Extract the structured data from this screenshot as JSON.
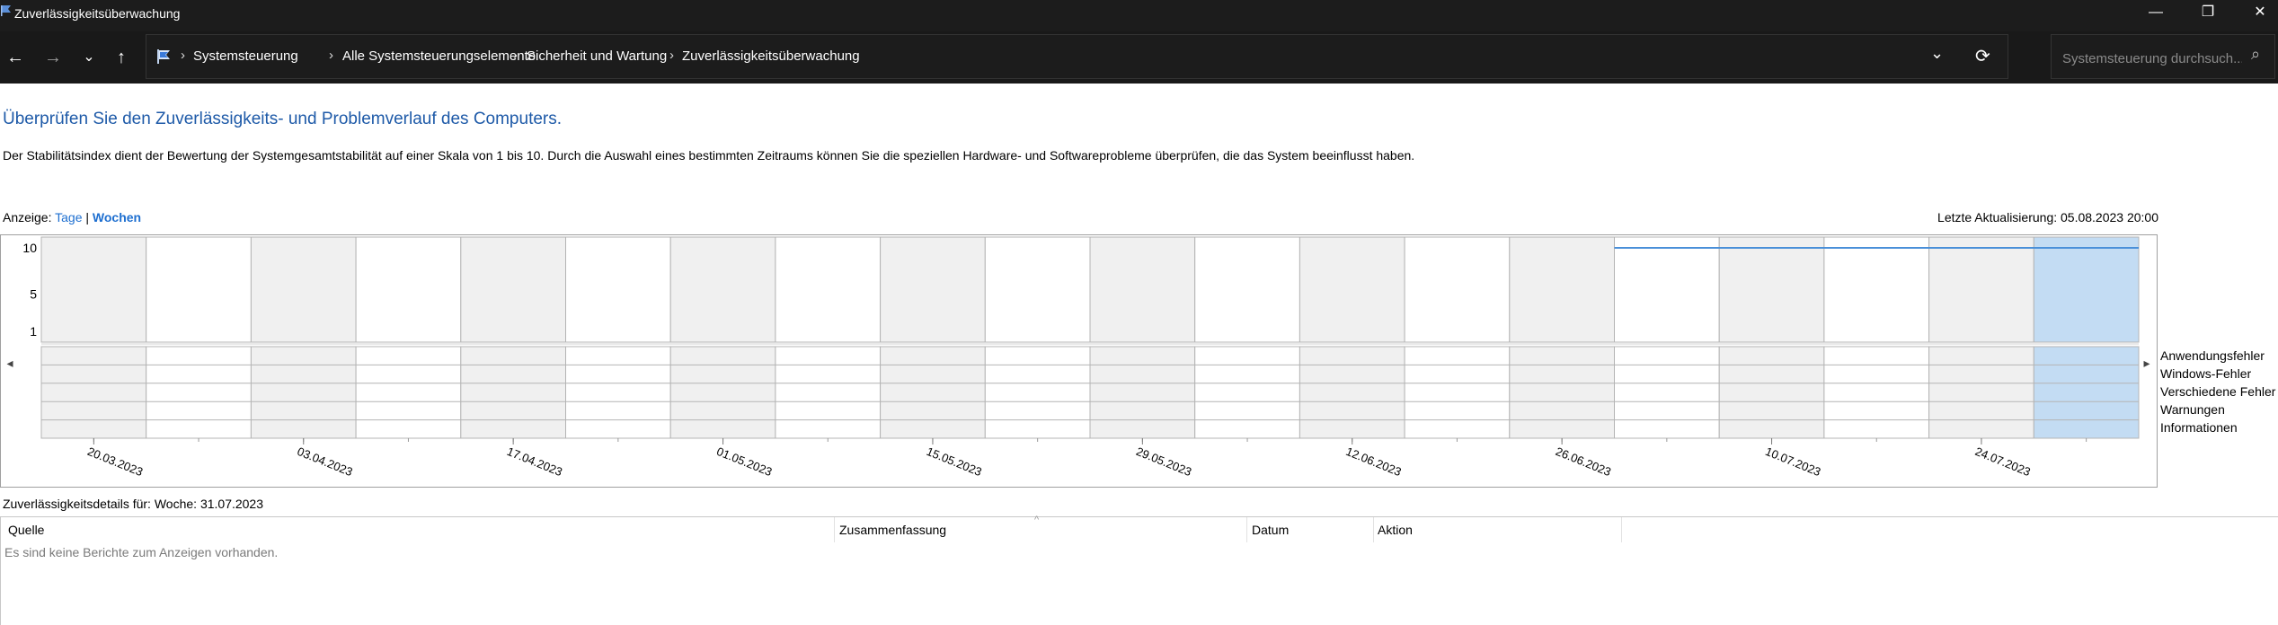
{
  "window": {
    "title": "Zuverlässigkeitsüberwachung",
    "controls": {
      "minimize": "—",
      "restore": "❐",
      "close": "✕"
    }
  },
  "toolbar": {
    "back": "←",
    "forward": "→",
    "recent": "⌄",
    "up": "↑",
    "breadcrumbs": [
      "Systemsteuerung",
      "Alle Systemsteuerungselemente",
      "Sicherheit und Wartung",
      "Zuverlässigkeitsüberwachung"
    ],
    "separator": "›",
    "dropdown": "⌄",
    "refresh": "⟳",
    "search_placeholder": "Systemsteuerung durchsuch...",
    "search_icon": "⌕"
  },
  "main": {
    "heading": "Überprüfen Sie den Zuverlässigkeits- und Problemverlauf des Computers.",
    "description": "Der Stabilitätsindex dient der Bewertung der Systemgesamtstabilität auf einer Skala von 1 bis 10. Durch die Auswahl eines bestimmten Zeitraums können Sie die speziellen Hardware- und Softwareprobleme überprüfen, die das System beeinflusst haben.",
    "view_label": "Anzeige: ",
    "view_days": "Tage",
    "view_sep": " | ",
    "view_weeks": "Wochen",
    "last_update": "Letzte Aktualisierung: 05.08.2023 20:00"
  },
  "chart_data": {
    "type": "line",
    "columns": 20,
    "selected_column": 19,
    "y_ticks": [
      "10",
      "5",
      "1"
    ],
    "ylim": [
      1,
      10
    ],
    "x_tick_labels": [
      "20.03.2023",
      "03.04.2023",
      "17.04.2023",
      "01.05.2023",
      "15.05.2023",
      "29.05.2023",
      "12.06.2023",
      "26.06.2023",
      "10.07.2023",
      "24.07.2023"
    ],
    "stability_series": {
      "start_column": 15,
      "values": [
        10,
        10,
        10,
        10,
        10
      ]
    },
    "event_rows": [
      "Anwendungsfehler",
      "Windows-Fehler",
      "Verschiedene Fehler",
      "Warnungen",
      "Informationen"
    ],
    "scroll_left": "◂",
    "scroll_right": "▸",
    "colors": {
      "shaded": "#f0f0f0",
      "grid": "#b4b4b4",
      "selected": "#c3dcf3",
      "line": "#4a90d9"
    }
  },
  "details": {
    "label": "Zuverlässigkeitsdetails für: Woche: 31.07.2023",
    "sort_caret": "^",
    "columns": [
      "Quelle",
      "Zusammenfassung",
      "Datum",
      "Aktion"
    ],
    "empty_text": "Es sind keine Berichte zum Anzeigen vorhanden."
  }
}
